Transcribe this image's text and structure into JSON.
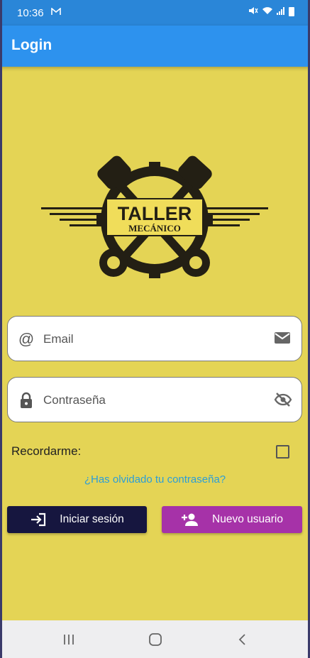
{
  "status_bar": {
    "time": "10:36",
    "mail_icon": "gmail-icon",
    "icons": [
      "mute-icon",
      "wifi-icon",
      "signal-icon",
      "battery-icon"
    ]
  },
  "app_bar": {
    "title": "Login"
  },
  "logo": {
    "line1": "TALLER",
    "line2": "MECÁNICO"
  },
  "form": {
    "email": {
      "placeholder": "Email",
      "value": ""
    },
    "password": {
      "placeholder": "Contraseña",
      "value": ""
    },
    "remember_label": "Recordarme:",
    "remember_checked": false,
    "forgot_link": "¿Has olvidado tu contraseña?"
  },
  "buttons": {
    "login_label": "Iniciar sesión",
    "new_user_label": "Nuevo usuario"
  },
  "colors": {
    "background": "#e4d455",
    "app_bar": "#2d92ee",
    "login_button": "#16163f",
    "new_user_button": "#a632a8",
    "link": "#2b9ed8"
  }
}
